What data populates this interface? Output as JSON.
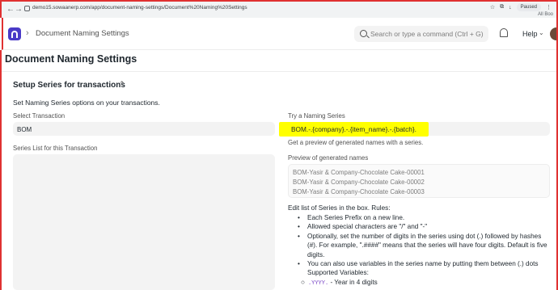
{
  "browser": {
    "url": "demo15.sowaanerp.com/app/document-naming-settings/Document%20Naming%20Settings",
    "profile_status": "Paused",
    "bookmarks_label": "All Boo"
  },
  "navbar": {
    "breadcrumb": "Document Naming Settings",
    "search_placeholder": "Search or type a command (Ctrl + G)",
    "help_label": "Help"
  },
  "page": {
    "title": "Document Naming Settings"
  },
  "section": {
    "title": "Setup Series for transactions",
    "description": "Set Naming Series options on your transactions."
  },
  "left": {
    "select_transaction_label": "Select Transaction",
    "select_transaction_value": "BOM",
    "series_list_label": "Series List for this Transaction"
  },
  "right": {
    "try_label": "Try a Naming Series",
    "try_value": "BOM.-.{company}.-.{item_name}.-.{batch}.",
    "try_help": "Get a preview of generated names with a series.",
    "preview_label": "Preview of generated names",
    "preview_lines": [
      "BOM-Yasir & Company-Chocolate Cake-00001",
      "BOM-Yasir & Company-Chocolate Cake-00002",
      "BOM-Yasir & Company-Chocolate Cake-00003"
    ],
    "rules_intro": "Edit list of Series in the box. Rules:",
    "rules": [
      "Each Series Prefix on a new line.",
      "Allowed special characters are \"/\" and \"-\"",
      "Optionally, set the number of digits in the series using dot (.) followed by hashes (#). For example, \".####\" means that the series will have four digits. Default is five digits.",
      "You can also use variables in the series name by putting them between (.) dots"
    ],
    "supported_variables_label": "Supported Variables:",
    "variable_code": ".YYYY.",
    "variable_desc": "- Year in 4 digits"
  }
}
